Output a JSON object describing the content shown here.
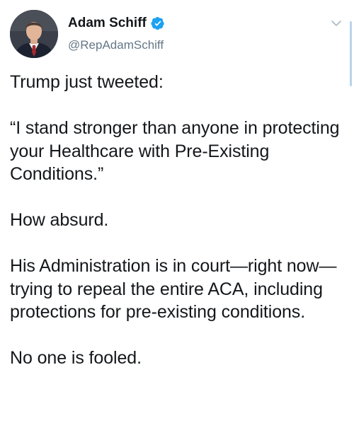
{
  "author": {
    "display_name": "Adam Schiff",
    "handle": "@RepAdamSchiff",
    "verified": true
  },
  "icons": {
    "verified": "verified-badge-icon",
    "menu": "chevron-down-icon"
  },
  "colors": {
    "verified_badge": "#1da1f2",
    "handle_text": "#657786",
    "body_text": "#14171a",
    "scrollbar": "#b8d4ea"
  },
  "tweet": {
    "paragraphs": [
      "Trump just tweeted:",
      "“I stand stronger than anyone in protecting your Healthcare with Pre-Existing Conditions.”",
      "How absurd.",
      "His Administration is in court—right now—trying to repeal the entire ACA, including protections for pre-existing conditions.",
      "No one is fooled."
    ]
  }
}
